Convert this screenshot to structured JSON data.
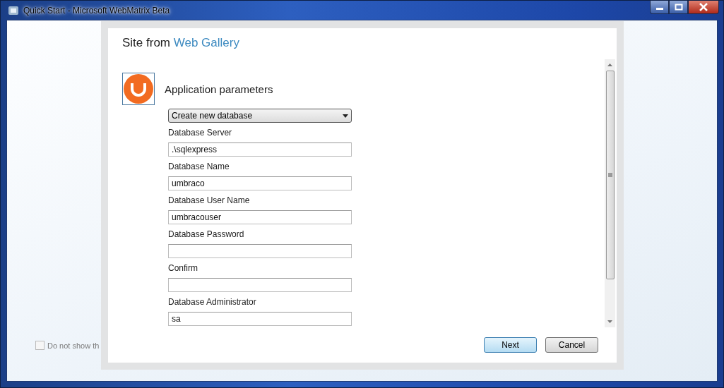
{
  "window": {
    "title": "Quick Start - Microsoft WebMatrix Beta"
  },
  "background_option": {
    "label": "Do not show th",
    "checked": false
  },
  "dialog": {
    "title": "Site from",
    "title_link": "Web Gallery",
    "section": "Application parameters",
    "database_mode": "Create new database",
    "fields": [
      {
        "label": "Database Server",
        "value": ".\\sqlexpress"
      },
      {
        "label": "Database Name",
        "value": "umbraco"
      },
      {
        "label": "Database User Name",
        "value": "umbracouser"
      },
      {
        "label": "Database Password"
      },
      {
        "label": "Confirm"
      },
      {
        "label": "Database Administrator",
        "value": "sa"
      }
    ],
    "buttons": [
      {
        "label": "Next",
        "kind": "primary"
      },
      {
        "label": "Cancel",
        "kind": "secondary"
      }
    ]
  }
}
